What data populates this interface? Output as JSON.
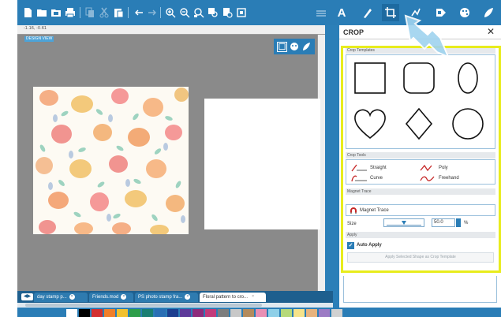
{
  "toolbar": {
    "left_icons": [
      "new-document-icon",
      "open-icon",
      "open-library-icon",
      "print-icon",
      "copy-icon",
      "cut-icon",
      "paste-icon",
      "undo-icon",
      "redo-icon",
      "zoom-in-icon",
      "zoom-out-icon",
      "zoom-fit-icon",
      "zoom-selection-icon",
      "zoom-page-icon",
      "fit-icon"
    ],
    "right_icons": [
      "grid-icon",
      "text-tool-icon",
      "draw-tool-icon",
      "crop-tool-icon",
      "trace-tool-icon",
      "send-icon",
      "palette-icon",
      "fill-icon"
    ],
    "text_tool_label": "A"
  },
  "canvas": {
    "ruler_coords": "-1.16, -0.61 ",
    "design_view_label": "DESIGN VIEW",
    "background_color": "#8a8a8a"
  },
  "view_tools": [
    "select-view-icon",
    "color-view-icon",
    "edit-view-icon"
  ],
  "tabs": {
    "items": [
      {
        "label": "day stamp p..."
      },
      {
        "label": "Friends.mod"
      },
      {
        "label": "PS photo stamp fra..."
      },
      {
        "label": "Floral pattern to cro..."
      }
    ],
    "active_index": 3
  },
  "palette": {
    "colors": [
      "#ffffff",
      "#000000",
      "#d32f2f",
      "#f07f2a",
      "#f2c12e",
      "#2e9e4a",
      "#1a7f72",
      "#2a6fb5",
      "#1c3e8f",
      "#5e3a9a",
      "#8e2b7c",
      "#c23b7a",
      "#7d7d7d",
      "#c8c8c8",
      "#b38b5d",
      "#e98fb4",
      "#8fd0e8",
      "#b6d97a",
      "#f6e38a",
      "#e8b37d",
      "#9c7bc4",
      "#d1d1d1"
    ]
  },
  "panel": {
    "title": "CROP",
    "close_label": "✕",
    "sections": {
      "templates": "Crop Templates",
      "tools": "Crop Tools",
      "magnet": "Magnet Trace",
      "apply": "Apply"
    },
    "shapes": [
      "square",
      "rounded-square",
      "ellipse",
      "heart",
      "diamond",
      "circle"
    ],
    "tools": [
      {
        "label": "Straight"
      },
      {
        "label": "Poly"
      },
      {
        "label": "Curve"
      },
      {
        "label": "Freehand"
      }
    ],
    "magnet_label": "Magnet Trace",
    "size_label": "Size",
    "size_value": "50.0",
    "size_unit": "%",
    "auto_apply_label": "Auto Apply",
    "auto_apply_checked": true,
    "apply_template_label": "Apply Selected Shape as Crop Template"
  },
  "colors": {
    "accent": "#2a7db6",
    "highlight": "#e8ec1d"
  }
}
